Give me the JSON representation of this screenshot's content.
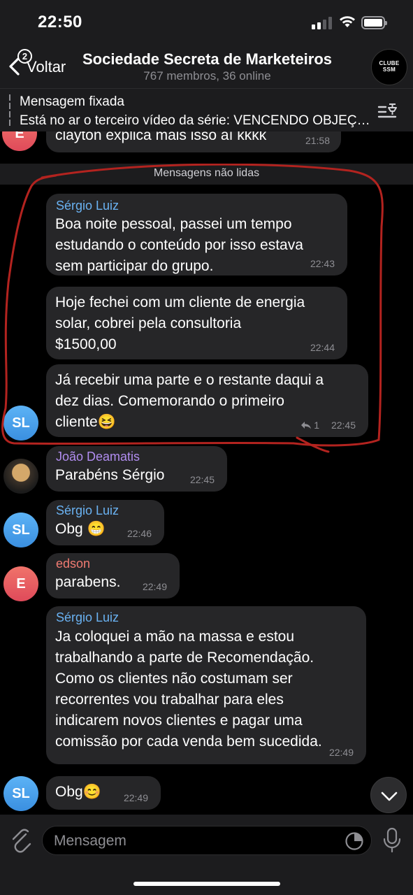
{
  "status_bar": {
    "time": "22:50"
  },
  "header": {
    "back_count": "2",
    "back_label": "Voltar",
    "title": "Sociedade Secreta de Marketeiros",
    "subtitle": "767 membros, 36 online",
    "group_avatar_line1": "CLUBE",
    "group_avatar_line2": "SSM"
  },
  "pinned": {
    "title": "Mensagem fixada",
    "text": "Está no ar o terceiro vídeo da série:  VENCENDO OBJEÇÕES"
  },
  "chat": {
    "previous_message": {
      "avatar": "E",
      "text": "clayton explica mais isso aí kkkk",
      "time": "21:58"
    },
    "unread_label": "Mensagens não lidas",
    "messages": [
      {
        "sender": "Sérgio Luiz",
        "lines": [
          "Boa noite pessoal, passei um tempo",
          "estudando o conteúdo por isso estava",
          "sem participar do grupo."
        ],
        "time": "22:43"
      },
      {
        "lines": [
          "Hoje fechei com um cliente de energia",
          "solar, cobrei pela consultoria",
          "$1500,00"
        ],
        "time": "22:44"
      },
      {
        "avatar": "SL",
        "lines": [
          "Já recebir uma parte e o restante daqui a",
          "dez dias. Comemorando o primeiro",
          "cliente😆"
        ],
        "replies": "1",
        "time": "22:45"
      },
      {
        "sender": "João Deamatis",
        "lines": [
          "Parabéns Sérgio"
        ],
        "time": "22:45"
      },
      {
        "sender": "Sérgio Luiz",
        "avatar": "SL",
        "lines": [
          "Obg 😁"
        ],
        "time": "22:46"
      },
      {
        "sender": "edson",
        "avatar": "E",
        "lines": [
          "parabens."
        ],
        "time": "22:49"
      },
      {
        "sender": "Sérgio Luiz",
        "lines": [
          "Ja coloquei a mão na massa e estou",
          "trabalhando a parte de Recomendação.",
          "Como os clientes não costumam ser",
          "recorrentes vou trabalhar para eles",
          "indicarem novos clientes e pagar uma",
          "comissão por cada venda bem sucedida."
        ],
        "time": "22:49"
      },
      {
        "avatar": "SL",
        "lines": [
          "Obg😊"
        ],
        "time": "22:49"
      }
    ]
  },
  "input": {
    "placeholder": "Mensagem"
  },
  "colors": {
    "sender_blue": "#6ab2f2",
    "sender_purple": "#b18df0",
    "sender_red": "#f07b72",
    "annotation_red": "#b3231f"
  }
}
